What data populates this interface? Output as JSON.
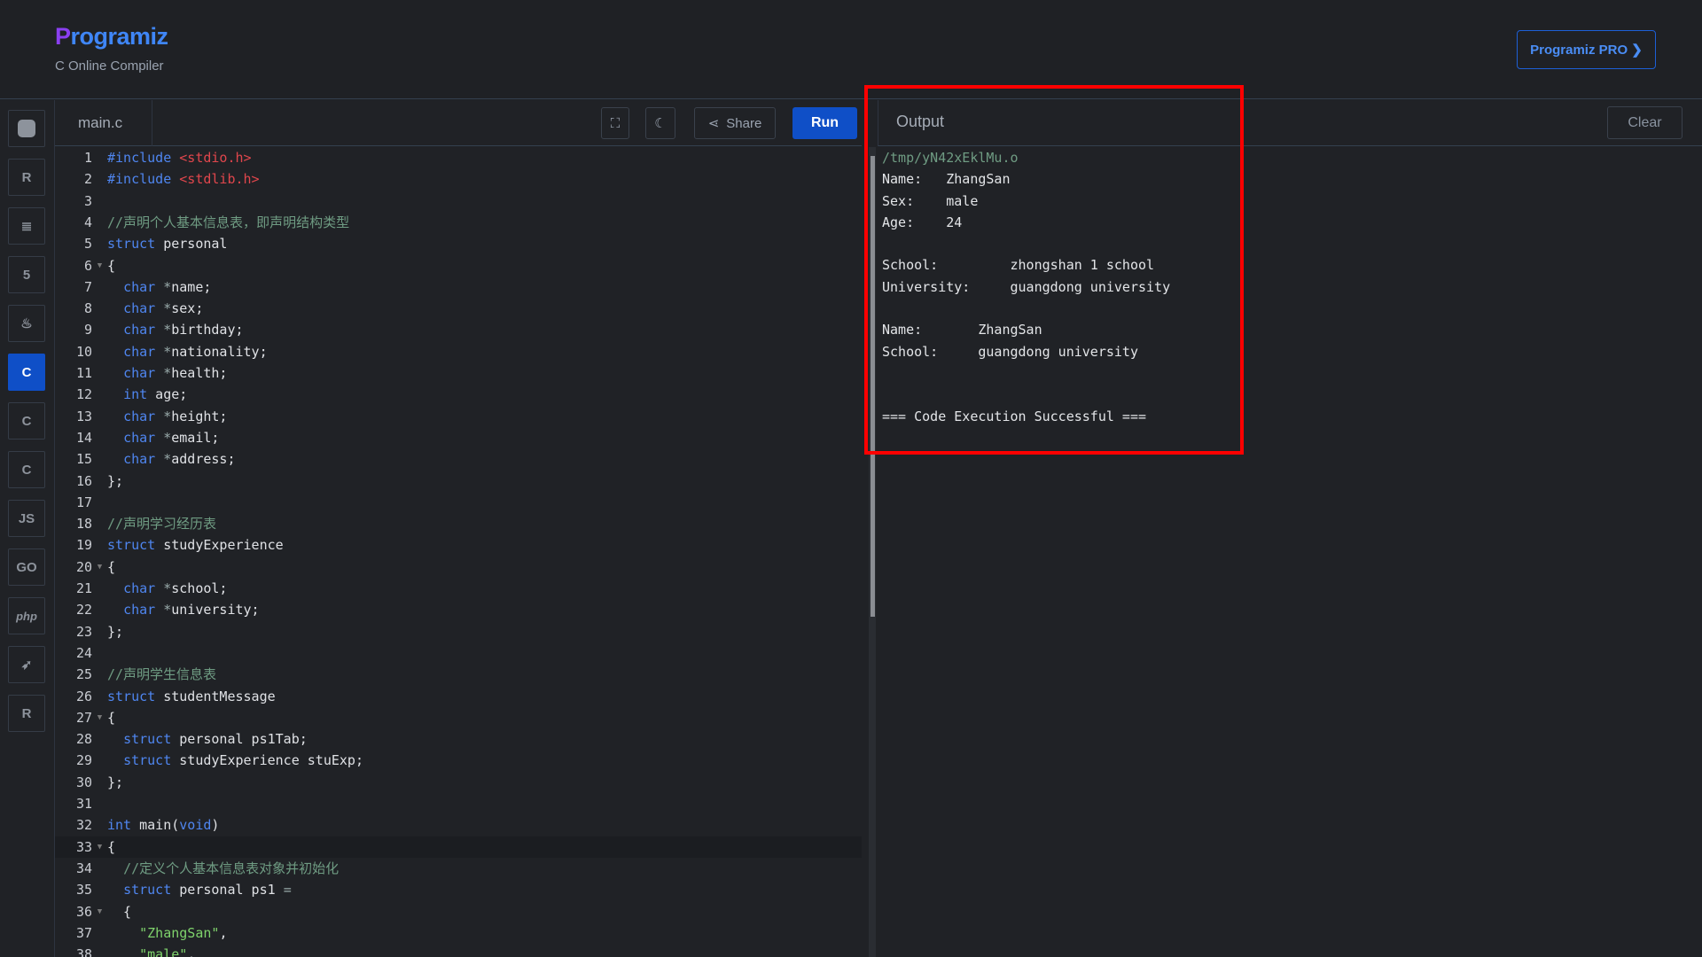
{
  "header": {
    "logo": "Programiz",
    "subtitle": "C Online Compiler",
    "pro_button": "Programiz PRO ❯"
  },
  "sidebar": {
    "items": [
      {
        "icon": "python-icon",
        "label": ""
      },
      {
        "icon": "r-icon",
        "label": "R"
      },
      {
        "icon": "database-icon",
        "label": "≣"
      },
      {
        "icon": "html5-icon",
        "label": "5"
      },
      {
        "icon": "java-icon",
        "label": "♨"
      },
      {
        "icon": "c-icon",
        "label": "C",
        "active": true
      },
      {
        "icon": "cpp-icon",
        "label": "C"
      },
      {
        "icon": "csharp-icon",
        "label": "C"
      },
      {
        "icon": "js-icon",
        "label": "JS"
      },
      {
        "icon": "go-icon",
        "label": "GO"
      },
      {
        "icon": "php-icon",
        "label": "php"
      },
      {
        "icon": "swift-icon",
        "label": "➶"
      },
      {
        "icon": "rust-icon",
        "label": "R"
      }
    ]
  },
  "editor": {
    "tab": "main.c",
    "share_label": "Share",
    "run_label": "Run",
    "lines": [
      [
        [
          "kw",
          "#include "
        ],
        [
          "inc",
          "<stdio.h>"
        ]
      ],
      [
        [
          "kw",
          "#include "
        ],
        [
          "inc",
          "<stdlib.h>"
        ]
      ],
      [],
      [
        [
          "cm",
          "//声明个人基本信息表，即声明结构类型"
        ]
      ],
      [
        [
          "kw",
          "struct"
        ],
        [
          "code",
          " personal"
        ]
      ],
      [
        [
          "code",
          "{"
        ]
      ],
      [
        [
          "code",
          "  "
        ],
        [
          "kw",
          "char"
        ],
        [
          "op",
          " *"
        ],
        [
          "code",
          "name;"
        ]
      ],
      [
        [
          "code",
          "  "
        ],
        [
          "kw",
          "char"
        ],
        [
          "op",
          " *"
        ],
        [
          "code",
          "sex;"
        ]
      ],
      [
        [
          "code",
          "  "
        ],
        [
          "kw",
          "char"
        ],
        [
          "op",
          " *"
        ],
        [
          "code",
          "birthday;"
        ]
      ],
      [
        [
          "code",
          "  "
        ],
        [
          "kw",
          "char"
        ],
        [
          "op",
          " *"
        ],
        [
          "code",
          "nationality;"
        ]
      ],
      [
        [
          "code",
          "  "
        ],
        [
          "kw",
          "char"
        ],
        [
          "op",
          " *"
        ],
        [
          "code",
          "health;"
        ]
      ],
      [
        [
          "code",
          "  "
        ],
        [
          "kw",
          "int"
        ],
        [
          "code",
          " age;"
        ]
      ],
      [
        [
          "code",
          "  "
        ],
        [
          "kw",
          "char"
        ],
        [
          "op",
          " *"
        ],
        [
          "code",
          "height;"
        ]
      ],
      [
        [
          "code",
          "  "
        ],
        [
          "kw",
          "char"
        ],
        [
          "op",
          " *"
        ],
        [
          "code",
          "email;"
        ]
      ],
      [
        [
          "code",
          "  "
        ],
        [
          "kw",
          "char"
        ],
        [
          "op",
          " *"
        ],
        [
          "code",
          "address;"
        ]
      ],
      [
        [
          "code",
          "};"
        ]
      ],
      [],
      [
        [
          "cm",
          "//声明学习经历表"
        ]
      ],
      [
        [
          "kw",
          "struct"
        ],
        [
          "code",
          " studyExperience"
        ]
      ],
      [
        [
          "code",
          "{"
        ]
      ],
      [
        [
          "code",
          "  "
        ],
        [
          "kw",
          "char"
        ],
        [
          "op",
          " *"
        ],
        [
          "code",
          "school;"
        ]
      ],
      [
        [
          "code",
          "  "
        ],
        [
          "kw",
          "char"
        ],
        [
          "op",
          " *"
        ],
        [
          "code",
          "university;"
        ]
      ],
      [
        [
          "code",
          "};"
        ]
      ],
      [],
      [
        [
          "cm",
          "//声明学生信息表"
        ]
      ],
      [
        [
          "kw",
          "struct"
        ],
        [
          "code",
          " studentMessage"
        ]
      ],
      [
        [
          "code",
          "{"
        ]
      ],
      [
        [
          "code",
          "  "
        ],
        [
          "kw",
          "struct"
        ],
        [
          "code",
          " personal ps1Tab;"
        ]
      ],
      [
        [
          "code",
          "  "
        ],
        [
          "kw",
          "struct"
        ],
        [
          "code",
          " studyExperience stuExp;"
        ]
      ],
      [
        [
          "code",
          "};"
        ]
      ],
      [],
      [
        [
          "kw",
          "int"
        ],
        [
          "code",
          " main("
        ],
        [
          "kw",
          "void"
        ],
        [
          "code",
          ")"
        ]
      ],
      [
        [
          "code",
          "{"
        ]
      ],
      [
        [
          "code",
          "  "
        ],
        [
          "cm",
          "//定义个人基本信息表对象并初始化"
        ]
      ],
      [
        [
          "code",
          "  "
        ],
        [
          "kw",
          "struct"
        ],
        [
          "code",
          " personal ps1 "
        ],
        [
          "op",
          "="
        ]
      ],
      [
        [
          "code",
          "  {"
        ]
      ],
      [
        [
          "code",
          "    "
        ],
        [
          "str",
          "\"ZhangSan\""
        ],
        [
          "code",
          ","
        ]
      ],
      [
        [
          "code",
          "    "
        ],
        [
          "str",
          "\"male\""
        ],
        [
          "code",
          ","
        ]
      ]
    ],
    "fold_lines": [
      6,
      20,
      27,
      33,
      36
    ],
    "current_line": 33
  },
  "output": {
    "title": "Output",
    "clear_label": "Clear",
    "lines": [
      "/tmp/yN42xEklMu.o",
      "Name:   ZhangSan",
      "Sex:    male",
      "Age:    24",
      "",
      "School:         zhongshan 1 school",
      "University:     guangdong university",
      "",
      "Name:       ZhangSan",
      "School:     guangdong university",
      "",
      "",
      "=== Code Execution Successful ==="
    ]
  }
}
